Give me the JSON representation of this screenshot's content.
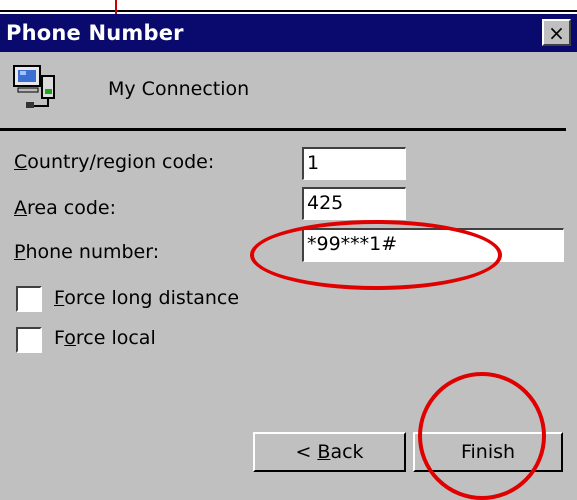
{
  "window": {
    "title": "Phone Number",
    "close_label": "×"
  },
  "connection": {
    "name": "My Connection",
    "icon": "network-computer-icon"
  },
  "fields": {
    "country_label_first": "C",
    "country_label_rest": "ountry/region code:",
    "country_value": "1",
    "area_label_first": "A",
    "area_label_rest": "rea code:",
    "area_value": "425",
    "phone_label_first": "P",
    "phone_label_rest": "hone number:",
    "phone_value": "*99***1#"
  },
  "options": {
    "force_long_first": "F",
    "force_long_rest": "orce long distance",
    "force_local_pre": "F",
    "force_local_ul": "o",
    "force_local_rest": "rce local"
  },
  "buttons": {
    "back_pre": "< ",
    "back_ul": "B",
    "back_rest": "ack",
    "finish": "Finish"
  },
  "colors": {
    "titlebar": "#0a0a6e",
    "annotation": "#e00000",
    "dialog_bg": "#c0c0c0"
  }
}
